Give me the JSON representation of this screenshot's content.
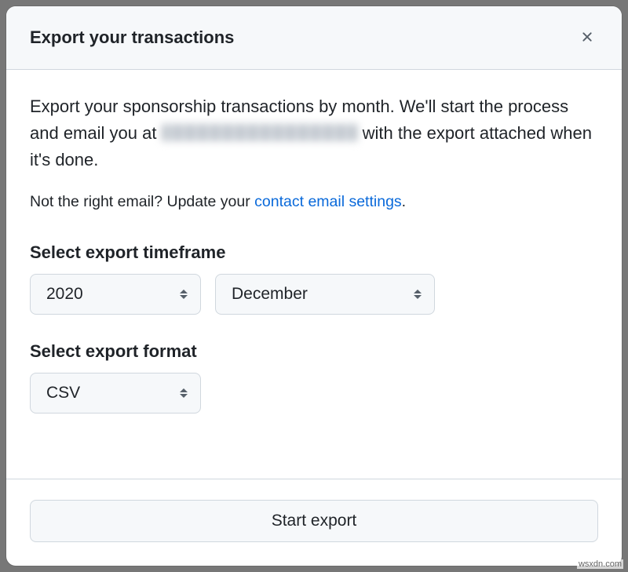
{
  "header": {
    "title": "Export your transactions"
  },
  "body": {
    "intro_before_email": "Export your sponsorship transactions by month. We'll start the process and email you at ",
    "intro_after_email": " with the export attached when it's done.",
    "helper_prefix": "Not the right email? Update your ",
    "helper_link": "contact email settings",
    "helper_suffix": ".",
    "timeframe_label": "Select export timeframe",
    "year_value": "2020",
    "month_value": "December",
    "format_label": "Select export format",
    "format_value": "CSV"
  },
  "footer": {
    "start_label": "Start export"
  },
  "watermark": "wsxdn.com"
}
